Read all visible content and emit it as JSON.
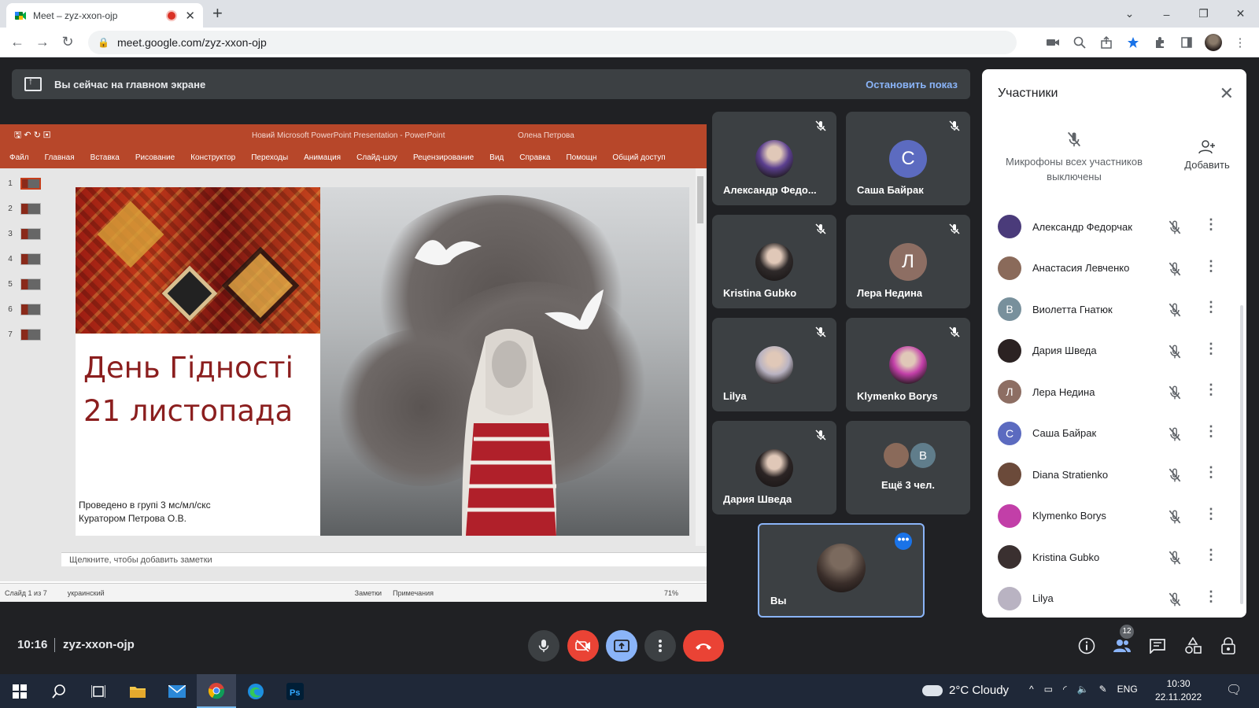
{
  "browser": {
    "tab_title": "Meet – zyz-xxon-ojp",
    "tab_close": "✕",
    "new_tab": "+",
    "url": "meet.google.com/zyz-xxon-ojp",
    "window_controls": [
      "⌄",
      "–",
      "❐",
      "✕"
    ]
  },
  "banner": {
    "text": "Вы сейчас на главном экране",
    "stop_label": "Остановить показ"
  },
  "presentation": {
    "window_title": "Новий Microsoft PowerPoint Presentation  -  PowerPoint",
    "user": "Олена Петрова",
    "menu": [
      "Файл",
      "Главная",
      "Вставка",
      "Рисование",
      "Конструктор",
      "Переходы",
      "Анимация",
      "Слайд-шоу",
      "Рецензирование",
      "Вид",
      "Справка",
      "Помощн",
      "Общий доступ"
    ],
    "thumb_numbers": [
      "1",
      "2",
      "3",
      "4",
      "5",
      "6",
      "7"
    ],
    "slide_title_line1": "День Гідності",
    "slide_title_line2": "21 листопада",
    "slide_sub_line1": "Проведено в групі 3 мс/мл/скс",
    "slide_sub_line2": "Куратором Петрова О.В.",
    "notes_placeholder": "Щелкните, чтобы добавить заметки",
    "status_slide": "Слайд 1 из 7",
    "status_lang": "украинский",
    "status_notes": "Заметки",
    "status_comments": "Примечания",
    "status_zoom": "71%"
  },
  "tiles": [
    {
      "name": "Александр Федо...",
      "avatar": "photo",
      "color": "#5b3f8f"
    },
    {
      "name": "Саша Байрак",
      "avatar": "С",
      "color": "#5c6bc0"
    },
    {
      "name": "Kristina Gubko",
      "avatar": "photo",
      "color": "#2f2a2a"
    },
    {
      "name": "Лера Недина",
      "avatar": "Л",
      "color": "#8d6e63"
    },
    {
      "name": "Lilya",
      "avatar": "photo",
      "color": "#b9b3c2"
    },
    {
      "name": "Klymenko Borys",
      "avatar": "photo",
      "color": "#c23fa8"
    },
    {
      "name": "Дария Шведа",
      "avatar": "photo",
      "color": "#2b2424"
    },
    {
      "name": "Ещё 3 чел.",
      "avatar": "В",
      "color": "#607d8b"
    }
  ],
  "self_tile": {
    "name": "Вы"
  },
  "panel": {
    "title": "Участники",
    "mute_all": "Микрофоны всех участников выключены",
    "add_label": "Добавить",
    "participants": [
      {
        "name": "Александр Федорчак",
        "avatar": "",
        "color": "#4a3b7a"
      },
      {
        "name": "Анастасия Левченко",
        "avatar": "",
        "color": "#8a6a5a"
      },
      {
        "name": "Виолетта Гнатюк",
        "avatar": "В",
        "color": "#78909c"
      },
      {
        "name": "Дария Шведа",
        "avatar": "",
        "color": "#2b2222"
      },
      {
        "name": "Лера Недина",
        "avatar": "Л",
        "color": "#8d6e63"
      },
      {
        "name": "Саша Байрак",
        "avatar": "С",
        "color": "#5c6bc0"
      },
      {
        "name": "Diana Stratienko",
        "avatar": "",
        "color": "#6b4a3a"
      },
      {
        "name": "Klymenko Borys",
        "avatar": "",
        "color": "#c23fa8"
      },
      {
        "name": "Kristina Gubko",
        "avatar": "",
        "color": "#3a3030"
      },
      {
        "name": "Lilya",
        "avatar": "",
        "color": "#b9b3c2"
      }
    ]
  },
  "bottom": {
    "time": "10:16",
    "meeting_code": "zyz-xxon-ojp",
    "participants_count": "12"
  },
  "taskbar": {
    "weather": "2°C  Cloudy",
    "lang": "ENG",
    "time": "10:30",
    "date": "22.11.2022"
  }
}
